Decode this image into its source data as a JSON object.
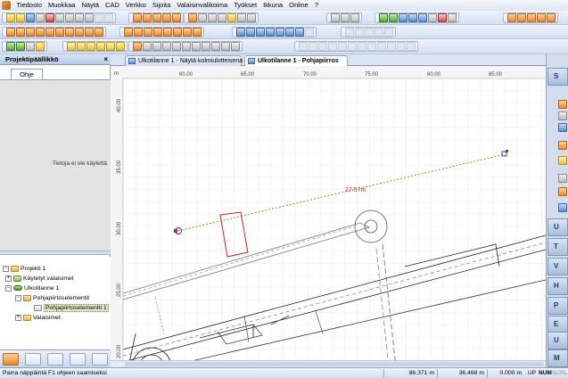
{
  "menu": [
    "Tiedosto",
    "Muokkaa",
    "Näytä",
    "CAD",
    "Verkko",
    "Sijoita",
    "Valaisinvalikoima",
    "Työkset",
    "Ikkuna",
    "Online",
    "?"
  ],
  "left_panel": {
    "title": "Projektipäällikkö",
    "close": "×",
    "tab": "Ohje",
    "info_text": "Tietoja ei ole käytettä",
    "tree": [
      {
        "label": "Projekti 1",
        "level": 0
      },
      {
        "label": "Käytetyt valaisimet",
        "level": 1
      },
      {
        "label": "Ulkotilanne 1",
        "level": 1
      },
      {
        "label": "Pohjapiirtoselementit",
        "level": 2
      },
      {
        "label": "Pohjapiirtoselementti 1",
        "level": 3
      },
      {
        "label": "Valaisimet",
        "level": 2
      }
    ]
  },
  "doc_tabs": [
    {
      "label": "Ulkotilanne 1 - Näytä kolmiulotteisena",
      "active": false
    },
    {
      "label": "Ulkotilanne 1 - Pohjapiirros",
      "active": true
    }
  ],
  "ruler": {
    "unit": "m",
    "x_labels": [
      "60.00",
      "65.00",
      "70.00",
      "75.00",
      "80.00",
      "85.00"
    ],
    "y_labels": [
      "40.00",
      "35.00",
      "30.00",
      "25.00",
      "20.00"
    ]
  },
  "measurement": {
    "label": "27.57m",
    "color": "#d41f1f"
  },
  "right_palette": [
    "S",
    "U",
    "T",
    "V",
    "H",
    "P",
    "E",
    "U",
    "M"
  ],
  "status": {
    "message": "Paina näppäintä F1 ohjeen saamiseksi",
    "x": "86.371 m",
    "y": "36.468 m",
    "z": "0.000 m",
    "flags": [
      "UP",
      "NUM",
      "SCRL"
    ]
  },
  "colors": {
    "accent": "#2f5ea8",
    "measure": "#d41f1f",
    "selection": "#d41f1f"
  }
}
